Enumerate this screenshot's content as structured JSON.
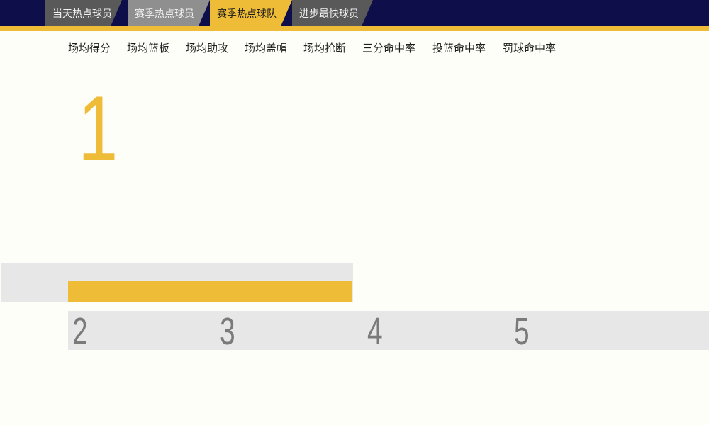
{
  "top_tabs": [
    {
      "label": "当天热点球员",
      "state": "normal"
    },
    {
      "label": "赛季热点球员",
      "state": "normal"
    },
    {
      "label": "赛季热点球队",
      "state": "active"
    },
    {
      "label": "进步最快球员",
      "state": "normal"
    }
  ],
  "stat_tabs": [
    {
      "label": "场均得分"
    },
    {
      "label": "场均篮板"
    },
    {
      "label": "场均助攻"
    },
    {
      "label": "场均盖帽"
    },
    {
      "label": "场均抢断"
    },
    {
      "label": "三分命中率"
    },
    {
      "label": "投篮命中率"
    },
    {
      "label": "罚球命中率"
    }
  ],
  "ranking": {
    "first": "1",
    "others": [
      "2",
      "3",
      "4",
      "5"
    ]
  },
  "colors": {
    "nav_bg": "#0e0e4a",
    "accent": "#efbc38",
    "panel_gray": "#e6e7e6",
    "rank_text": "#7a7a7a"
  }
}
